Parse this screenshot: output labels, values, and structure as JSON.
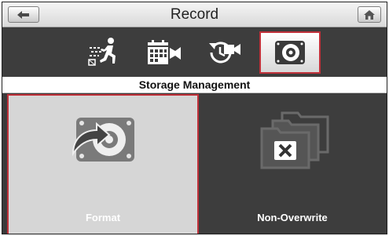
{
  "window": {
    "title": "Record"
  },
  "header": {
    "back_icon": "back-arrow-icon",
    "home_icon": "home-icon"
  },
  "tabs": [
    {
      "icon": "motion-detection-icon"
    },
    {
      "icon": "schedule-record-icon"
    },
    {
      "icon": "playback-record-icon"
    },
    {
      "icon": "hard-disk-icon",
      "active": true
    }
  ],
  "section": {
    "title": "Storage Management"
  },
  "options": {
    "format": {
      "label": "Format",
      "icon": "format-disk-icon"
    },
    "non_overwrite": {
      "label": "Non-Overwrite",
      "icon": "non-overwrite-icon"
    }
  },
  "colors": {
    "accent": "#c0313a",
    "dark_bg": "#3d3d3d",
    "selected_bg": "#d6d6d6"
  }
}
